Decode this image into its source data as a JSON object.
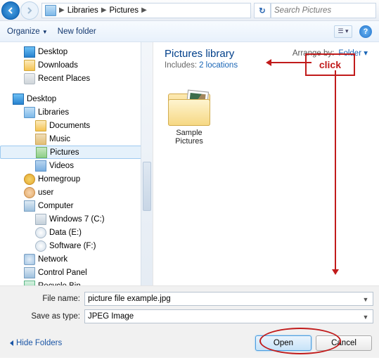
{
  "breadcrumb": {
    "root_icon": "library-icon",
    "items": [
      "Libraries",
      "Pictures"
    ]
  },
  "search": {
    "placeholder": "Search Pictures"
  },
  "toolbar": {
    "organize": "Organize",
    "newfolder": "New folder"
  },
  "tree": {
    "group1": [
      {
        "icon": "ico-desk",
        "label": "Desktop"
      },
      {
        "icon": "ico-folder",
        "label": "Downloads"
      },
      {
        "icon": "ico-recent",
        "label": "Recent Places"
      }
    ],
    "desktop_label": "Desktop",
    "libraries_label": "Libraries",
    "libs": [
      {
        "icon": "ico-folder",
        "label": "Documents"
      },
      {
        "icon": "ico-music",
        "label": "Music"
      },
      {
        "icon": "ico-pic",
        "label": "Pictures",
        "selected": true
      },
      {
        "icon": "ico-vid",
        "label": "Videos"
      }
    ],
    "rest": [
      {
        "icon": "ico-home",
        "label": "Homegroup",
        "lv": 1
      },
      {
        "icon": "ico-user",
        "label": "user",
        "lv": 1
      },
      {
        "icon": "ico-comp",
        "label": "Computer",
        "lv": 1
      },
      {
        "icon": "ico-drive",
        "label": "Windows 7 (C:)",
        "lv": 2
      },
      {
        "icon": "ico-disc",
        "label": "Data (E:)",
        "lv": 2
      },
      {
        "icon": "ico-disc",
        "label": "Software (F:)",
        "lv": 2
      },
      {
        "icon": "ico-net",
        "label": "Network",
        "lv": 1
      },
      {
        "icon": "ico-comp",
        "label": "Control Panel",
        "lv": 1
      },
      {
        "icon": "ico-recycle",
        "label": "Recycle Bin",
        "lv": 1
      }
    ]
  },
  "content": {
    "title": "Pictures library",
    "includes_prefix": "Includes:",
    "includes_link": "2 locations",
    "arrange_prefix": "Arrange by:",
    "arrange_value": "Folder",
    "item_label": "Sample Pictures"
  },
  "callout": {
    "text": "click"
  },
  "form": {
    "filename_label": "File name:",
    "filename_value": "picture file example.jpg",
    "saveas_label": "Save as type:",
    "saveas_value": "JPEG Image"
  },
  "footer": {
    "hide_folders": "Hide Folders",
    "open": "Open",
    "cancel": "Cancel"
  }
}
